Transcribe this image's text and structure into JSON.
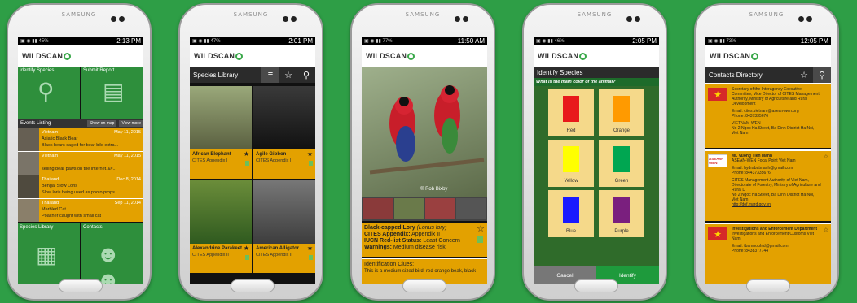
{
  "device_brand": "SAMSUNG",
  "app_logo": "WILDSCAN",
  "colors": {
    "background": "#2e9e46",
    "accent_orange": "#e3a100",
    "tile_green": "#2e8f3c",
    "dark_bar": "#2b2b2b"
  },
  "phones": [
    {
      "time": "2:13 PM",
      "battery": "45%"
    },
    {
      "time": "2:01 PM",
      "battery": "47%"
    },
    {
      "time": "11:50 AM",
      "battery": "77%"
    },
    {
      "time": "2:05 PM",
      "battery": "46%"
    },
    {
      "time": "12:05 PM",
      "battery": "73%"
    }
  ],
  "home": {
    "tiles": {
      "identify": "Identify Species",
      "submit": "Submit Report",
      "library": "Species Library",
      "contacts": "Contacts"
    },
    "events_title": "Events Listing",
    "show_on_map": "Show on map",
    "view_more": "View more",
    "events": [
      {
        "location": "Vietnam",
        "date": "May 11, 2015",
        "title": "Asiatic Black Bear",
        "desc": "Black bears caged for bear bile extra..."
      },
      {
        "location": "Vietnam",
        "date": "May 11, 2015",
        "title": "",
        "desc": "selling bear paws on the internet.&#..."
      },
      {
        "location": "Thailand",
        "date": "Dec 8, 2014",
        "title": "Bengal Slow Loris",
        "desc": "Slow loris being used as photo props ..."
      },
      {
        "location": "Thailand",
        "date": "Sep 11, 2014",
        "title": "Marbled Cat",
        "desc": "Poacher caught with small cat"
      }
    ]
  },
  "library": {
    "title": "Species Library",
    "cards": [
      {
        "name": "African Elephant",
        "appendix": "CITES Appendix I"
      },
      {
        "name": "Agile Gibbon",
        "appendix": "CITES Appendix I"
      },
      {
        "name": "Alexandrine Parakeet",
        "appendix": "CITES Appendix II"
      },
      {
        "name": "American Alligator",
        "appendix": "CITES Appendix II"
      }
    ]
  },
  "species_detail": {
    "photo_credit": "© Rob Bixby",
    "name": "Black-capped Lory",
    "latin": "(Lorius lory)",
    "appendix_label": "CITES Appendix:",
    "appendix_value": "Appendix II",
    "iucn_label": "IUCN Red-list Status:",
    "iucn_value": "Least Concern",
    "warnings_label": "Warnings:",
    "warnings_value": "Medium disease risk",
    "clues_title": "Identification Clues:",
    "clues_text": "This is a medium sized bird, red orange beak, black"
  },
  "identify": {
    "title": "Identify Species",
    "question": "What is the main color of the animal?",
    "colors": [
      {
        "label": "Red",
        "hex": "#e8191b"
      },
      {
        "label": "Orange",
        "hex": "#ff9a00"
      },
      {
        "label": "Yellow",
        "hex": "#ffff00"
      },
      {
        "label": "Green",
        "hex": "#00a651"
      },
      {
        "label": "Blue",
        "hex": "#1a1aff"
      },
      {
        "label": "Purple",
        "hex": "#7a1f7e"
      }
    ],
    "cancel": "Cancel",
    "identify_btn": "Identify"
  },
  "contacts": {
    "title": "Contacts Directory",
    "entries": [
      {
        "name": "",
        "org": "Secretary of the Interagency Executive Committee, Vice Director of CITES Management Authority, Ministry of Agriculture and Rural Development",
        "email": "Email: cites.vietnam@asean-wen.org",
        "phone": "Phone: 8437335676",
        "extra": "VIETNAM-WEN",
        "addr": "No 2 Ngoc Ha Street, Ba Dinh District Ha Noi, Viet Nam"
      },
      {
        "name": "Mr. Vuong Tien Manh",
        "org": "ASEAN-WEN Focal Point Viet Nam",
        "email": "Email: hydrabatmanh@gmail.com",
        "phone": "Phone: 84437335676",
        "extra": "CITES Management Authority of Viet Nam, Directorate of Forestry, Ministry of Agriculture and Rural D",
        "addr": "No 2 Ngoc Ha Street, Ba Dinh District Ha Noi, Viet Nam",
        "url": "http://dof.mard.gov.vn",
        "badge": "ASEAN-WEN"
      },
      {
        "name": "Investigations and Enforcement Department",
        "org": "Investigations and Enforcement Customs Viet Nam",
        "email": "Email: tbamnouhtd@gmail.com",
        "phone": "Phone: 8438377744"
      }
    ]
  }
}
